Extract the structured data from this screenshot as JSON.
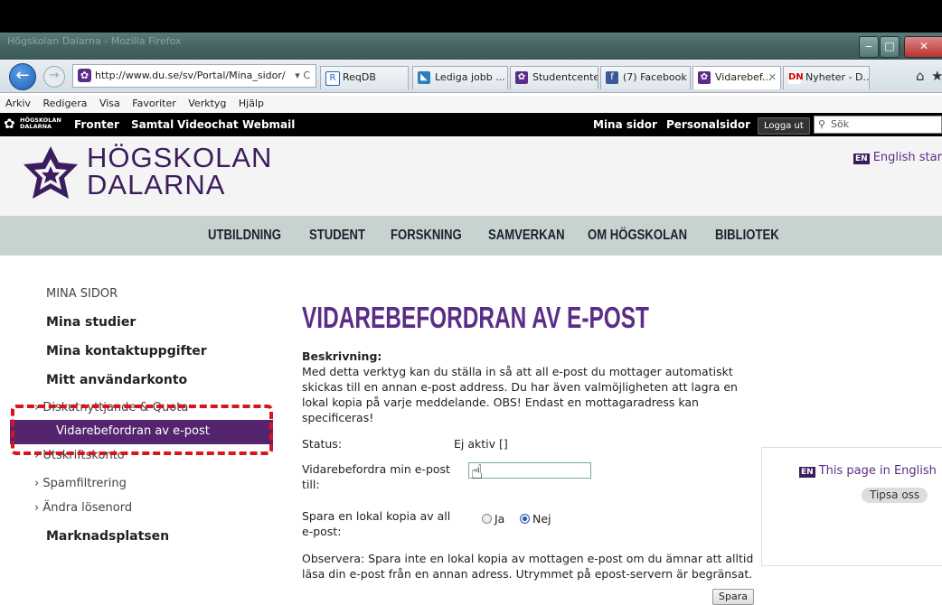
{
  "browser": {
    "title": "Högskolan Dalarna - Mozilla Firefox",
    "url": "http://www.du.se/sv/Portal/Mina_sidor/",
    "tabs": [
      "ReqDB",
      "Lediga jobb ...",
      "Studentcenter",
      "(7) Facebook",
      "Vidarebef...",
      "Nyheter - D..."
    ],
    "menu": [
      "Arkiv",
      "Redigera",
      "Visa",
      "Favoriter",
      "Verktyg",
      "Hjälp"
    ]
  },
  "sitebar": {
    "logo": "HÖGSKOLAN DALARNA",
    "links": [
      "Fronter",
      "Samtal",
      "Videochat",
      "Webmail"
    ],
    "right_links": [
      "Mina sidor",
      "Personalsidor"
    ],
    "logout": "Logga ut",
    "search_placeholder": "Sök"
  },
  "header": {
    "logo_line1": "HÖGSKOLAN",
    "logo_line2": "DALARNA",
    "english_start": "English startp",
    "en_badge": "EN"
  },
  "mainnav": [
    "UTBILDNING",
    "STUDENT",
    "FORSKNING",
    "SAMVERKAN",
    "OM HÖGSKOLAN",
    "BIBLIOTEK"
  ],
  "sidebar": {
    "heading": "MINA SIDOR",
    "items": [
      "Mina studier",
      "Mina kontaktuppgifter",
      "Mitt användarkonto"
    ],
    "subitems": [
      "Diskutnyttjande & Quota",
      "Vidarebefordran av e-post",
      "Utskriftskonto",
      "Spamfiltrering",
      "Ändra lösenord"
    ],
    "last": "Marknadsplatsen"
  },
  "content": {
    "title": "VIDAREBEFORDRAN AV E-POST",
    "desc_label": "Beskrivning:",
    "desc": "Med detta verktyg kan du ställa in så att all e-post du mottager automatiskt skickas till en annan e-post address. Du har även valmöjligheten att lagra en lokal kopia på varje meddelande. OBS! Endast en mottagaradress kan specificeras!",
    "status_label": "Status:",
    "status_value": "Ej aktiv []",
    "forward_label": "Vidarebefordra min e-post till:",
    "copy_label": "Spara en lokal kopia av all e-post:",
    "opt_yes": "Ja",
    "opt_no": "Nej",
    "note": "Observera: Spara inte en lokal kopia av mottagen e-post om du ämnar att alltid läsa din e-post från en annan adress. Utrymmet på epost-servern är begränsat.",
    "save": "Spara"
  },
  "rightbox": {
    "this_page": "This page in English",
    "tipsa": "Tipsa oss"
  },
  "colors": {
    "purple": "#5b2d88",
    "dark_purple": "#3b1d5e",
    "nav_bg": "#c7d3cf",
    "highlight_red": "#d8141c"
  }
}
